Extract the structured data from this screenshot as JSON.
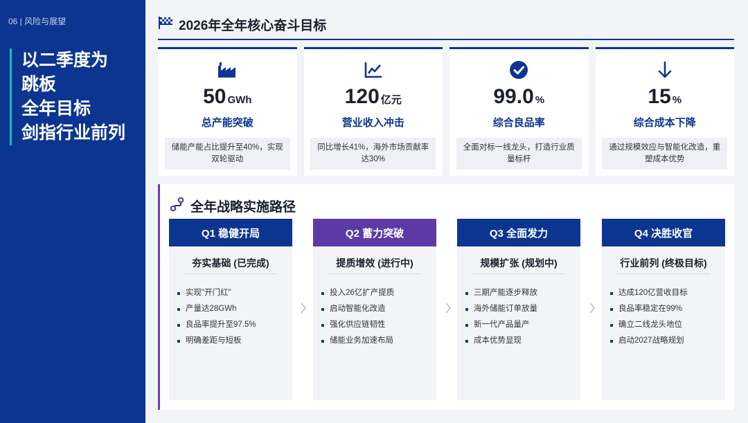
{
  "sidebar": {
    "section_label": "06 | 风险与展望",
    "headline": [
      "以二季度为",
      "跳板",
      "全年目标",
      "剑指行业前列"
    ]
  },
  "goals": {
    "title": "2026年全年核心奋斗目标",
    "icon": "checkered-flag-icon",
    "cards": [
      {
        "icon": "factory-icon",
        "value": "50",
        "unit": "GWh",
        "label": "总产能突破",
        "desc": "储能产能占比提升至40%，实现双轮驱动"
      },
      {
        "icon": "trend-chart-icon",
        "value": "120",
        "unit": "亿元",
        "label": "营业收入冲击",
        "desc": "同比增长41%，海外市场贡献率达30%"
      },
      {
        "icon": "check-circle-icon",
        "value": "99.0",
        "unit": "%",
        "label": "综合良品率",
        "desc": "全面对标一线龙头，打造行业质量标杆"
      },
      {
        "icon": "arrow-down-icon",
        "value": "15",
        "unit": "%",
        "label": "综合成本下降",
        "desc": "通过规模效应与智能化改造，重塑成本优势"
      }
    ]
  },
  "roadmap": {
    "title": "全年战略实施路径",
    "icon": "route-icon",
    "phases": [
      {
        "label": "Q1 稳健开局",
        "subtitle": "夯实基础 (已完成)",
        "items": [
          "实现\"开门红\"",
          "产量达28GWh",
          "良品率提升至97.5%",
          "明确差距与短板"
        ]
      },
      {
        "label": "Q2 蓄力突破",
        "subtitle": "提质增效 (进行中)",
        "items": [
          "投入26亿扩产提质",
          "启动智能化改造",
          "强化供应链韧性",
          "储能业务加速布局"
        ]
      },
      {
        "label": "Q3 全面发力",
        "subtitle": "规模扩张 (规划中)",
        "items": [
          "三期产能逐步释放",
          "海外储能订单放量",
          "新一代产品量产",
          "成本优势显现"
        ]
      },
      {
        "label": "Q4 决胜收官",
        "subtitle": "行业前列 (终极目标)",
        "items": [
          "达成120亿营收目标",
          "良品率稳定在99%",
          "确立二线龙头地位",
          "启动2027战略规划"
        ]
      }
    ]
  },
  "colors": {
    "primary": "#0b3590",
    "accent_purple": "#5b3aa6",
    "accent_teal": "#12c2a8"
  }
}
